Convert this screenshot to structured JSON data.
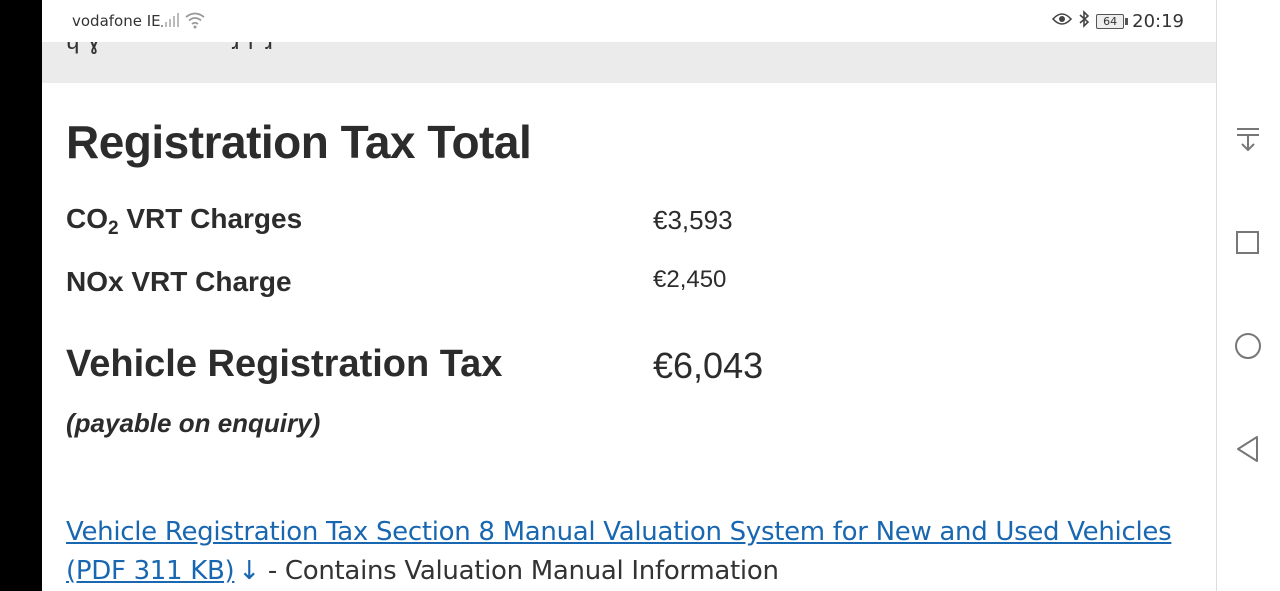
{
  "status_bar": {
    "carrier": "vodafone IE",
    "battery": "64",
    "time": "20:19"
  },
  "main": {
    "title": "Registration Tax Total",
    "rows": [
      {
        "label_prefix": "CO",
        "label_sub": "2",
        "label_suffix": " VRT Charges",
        "value": "€3,593"
      },
      {
        "label": "NOx VRT Charge",
        "value": "€2,450"
      }
    ],
    "total": {
      "label": "Vehicle Registration Tax",
      "value": "€6,043"
    },
    "payable_note": "(payable on enquiry)",
    "link": {
      "text": "Vehicle Registration Tax Section 8 Manual Valuation System for New and Used Vehicles (PDF 311 KB)",
      "arrow": "↓",
      "suffix": " - Contains Valuation Manual Information"
    }
  },
  "nav": {
    "icons": [
      "collapse-icon",
      "recent-apps-icon",
      "home-icon",
      "back-icon"
    ]
  },
  "colors": {
    "link": "#1967b1",
    "text": "#2c2c2c",
    "band": "#ebebeb"
  }
}
